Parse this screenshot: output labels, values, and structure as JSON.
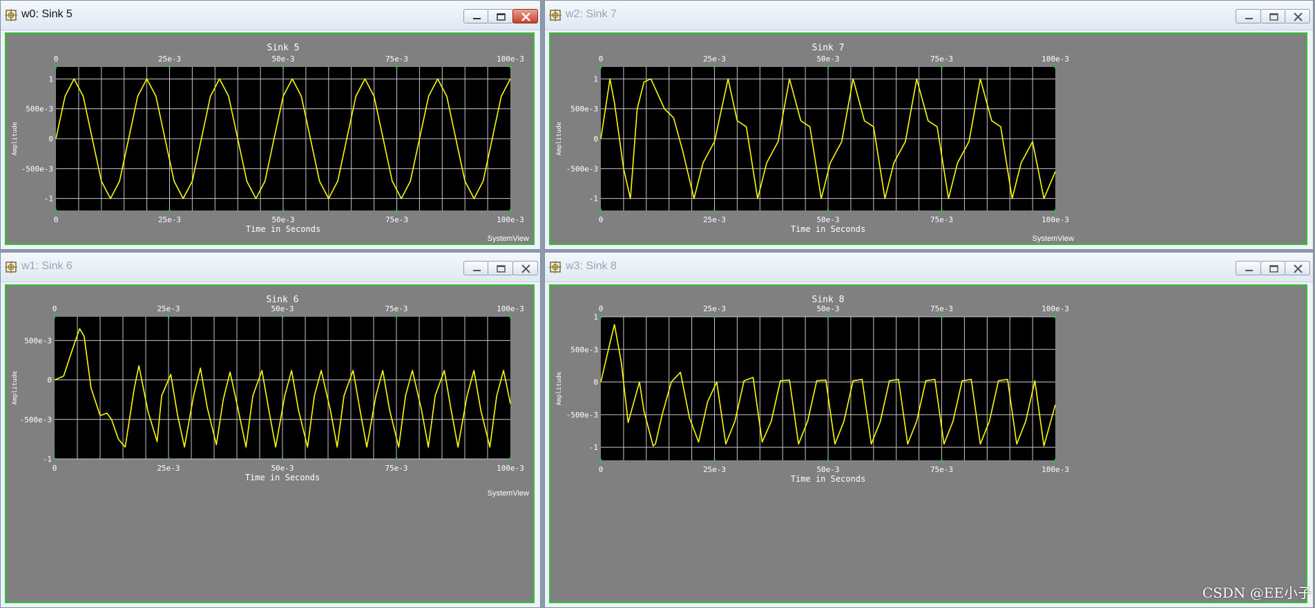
{
  "colors": {
    "trace": "#ffff00",
    "plot_bg": "#000000",
    "panel_bg": "#808080",
    "grid": "#c8c8c8",
    "frame": "#2ec32e"
  },
  "windows": [
    {
      "key": "w0",
      "title": "w0: Sink 5",
      "active": true,
      "brand": "SystemView",
      "icon": "systemview-sink-icon"
    },
    {
      "key": "w2",
      "title": "w2: Sink 7",
      "active": false,
      "brand": "SystemView",
      "icon": "systemview-sink-icon"
    },
    {
      "key": "w1",
      "title": "w1: Sink 6",
      "active": false,
      "brand": "SystemView",
      "icon": "systemview-sink-icon"
    },
    {
      "key": "w3",
      "title": "w3: Sink 8",
      "active": false,
      "brand": "",
      "icon": "systemview-sink-icon"
    }
  ],
  "controls": {
    "minimize": "minimize-icon",
    "restore": "restore-icon",
    "close": "close-icon"
  },
  "watermark": "CSDN @EE小子",
  "chart_data": [
    {
      "type": "line",
      "title": "Sink 5",
      "xlabel": "Time in Seconds",
      "ylabel": "Amplitude",
      "xlim": [
        0,
        0.1
      ],
      "ylim": [
        -1.2,
        1.2
      ],
      "xticks": [
        0,
        0.025,
        0.05,
        0.075,
        0.1
      ],
      "xtick_labels": [
        "0",
        "25e-3",
        "50e-3",
        "75e-3",
        "100e-3"
      ],
      "yticks": [
        1,
        0.5,
        0,
        -0.5,
        -1
      ],
      "ytick_labels": [
        "1",
        "500e-3",
        "0",
        "-500e-3",
        "-1"
      ],
      "grid": true,
      "series": [
        {
          "x": [
            0,
            0.002,
            0.004,
            0.006,
            0.008,
            0.01,
            0.012,
            0.014,
            0.016,
            0.018,
            0.02,
            0.022,
            0.024,
            0.026,
            0.028,
            0.03,
            0.032,
            0.034,
            0.036,
            0.038,
            0.04,
            0.042,
            0.044,
            0.046,
            0.048,
            0.05,
            0.052,
            0.054,
            0.056,
            0.058,
            0.06,
            0.062,
            0.064,
            0.066,
            0.068,
            0.07,
            0.072,
            0.074,
            0.076,
            0.078,
            0.08,
            0.082,
            0.084,
            0.086,
            0.088,
            0.09,
            0.092,
            0.094,
            0.096,
            0.098,
            0.1
          ],
          "y": [
            0,
            0.71,
            1.0,
            0.71,
            0,
            -0.71,
            -1.0,
            -0.71,
            0,
            0.71,
            1.0,
            0.71,
            0,
            -0.71,
            -1.0,
            -0.71,
            0,
            0.71,
            1.0,
            0.71,
            0,
            -0.71,
            -1.0,
            -0.71,
            0,
            0.71,
            1.0,
            0.71,
            0,
            -0.71,
            -1.0,
            -0.71,
            0,
            0.71,
            1.0,
            0.71,
            0,
            -0.71,
            -1.0,
            -0.71,
            0,
            0.71,
            1.0,
            0.71,
            0,
            -0.71,
            -1.0,
            -0.71,
            0,
            0.71,
            1.0
          ]
        }
      ]
    },
    {
      "type": "line",
      "title": "Sink 7",
      "xlabel": "Time in Seconds",
      "ylabel": "Amplitude",
      "xlim": [
        0,
        0.1
      ],
      "ylim": [
        -1.2,
        1.2
      ],
      "xticks": [
        0,
        0.025,
        0.05,
        0.075,
        0.1
      ],
      "xtick_labels": [
        "0",
        "25e-3",
        "50e-3",
        "75e-3",
        "100e-3"
      ],
      "yticks": [
        1,
        0.5,
        0,
        -0.5,
        -1
      ],
      "ytick_labels": [
        "1",
        "500e-3",
        "0",
        "-500e-3",
        "-1"
      ],
      "grid": true,
      "series": [
        {
          "x": [
            0,
            0.002,
            0.003,
            0.005,
            0.0065,
            0.008,
            0.0095,
            0.011,
            0.0125,
            0.014,
            0.016,
            0.018,
            0.0205,
            0.0225,
            0.025,
            0.028,
            0.03,
            0.032,
            0.0345,
            0.0365,
            0.039,
            0.0415,
            0.044,
            0.046,
            0.0485,
            0.0505,
            0.053,
            0.0555,
            0.058,
            0.06,
            0.0625,
            0.0645,
            0.067,
            0.0695,
            0.072,
            0.074,
            0.0765,
            0.0785,
            0.081,
            0.0835,
            0.086,
            0.088,
            0.0905,
            0.0925,
            0.095,
            0.0975,
            0.1
          ],
          "y": [
            0,
            1.0,
            0.6,
            -0.5,
            -1.0,
            0.5,
            0.95,
            1.0,
            0.75,
            0.5,
            0.35,
            -0.2,
            -1.0,
            -0.4,
            -0.05,
            1.0,
            0.3,
            0.2,
            -1.0,
            -0.4,
            -0.05,
            1.0,
            0.3,
            0.2,
            -1.0,
            -0.4,
            -0.05,
            1.0,
            0.3,
            0.2,
            -1.0,
            -0.4,
            -0.05,
            1.0,
            0.3,
            0.2,
            -1.0,
            -0.4,
            -0.05,
            1.0,
            0.3,
            0.2,
            -1.0,
            -0.4,
            -0.05,
            -1.0,
            -0.55
          ]
        }
      ]
    },
    {
      "type": "line",
      "title": "Sink 6",
      "xlabel": "Time in Seconds",
      "ylabel": "Amplitude",
      "xlim": [
        0,
        0.1
      ],
      "ylim": [
        -1.0,
        0.8
      ],
      "xticks": [
        0,
        0.025,
        0.05,
        0.075,
        0.1
      ],
      "xtick_labels": [
        "0",
        "25e-3",
        "50e-3",
        "75e-3",
        "100e-3"
      ],
      "yticks": [
        0.5,
        0,
        -0.5,
        -1
      ],
      "ytick_labels": [
        "500e-3",
        "0",
        "-500e-3",
        "-1"
      ],
      "grid": true,
      "series": [
        {
          "x": [
            0,
            0.002,
            0.004,
            0.0055,
            0.0065,
            0.008,
            0.01,
            0.0115,
            0.0125,
            0.014,
            0.0155,
            0.0175,
            0.0185,
            0.0205,
            0.0225,
            0.0235,
            0.0255,
            0.027,
            0.0285,
            0.0305,
            0.032,
            0.0335,
            0.0355,
            0.037,
            0.0385,
            0.04,
            0.042,
            0.0435,
            0.0455,
            0.047,
            0.0485,
            0.0505,
            0.052,
            0.0535,
            0.0555,
            0.057,
            0.0585,
            0.0605,
            0.062,
            0.0635,
            0.0655,
            0.067,
            0.0685,
            0.0705,
            0.072,
            0.0735,
            0.0755,
            0.077,
            0.0785,
            0.0805,
            0.082,
            0.0835,
            0.0855,
            0.087,
            0.0885,
            0.0905,
            0.092,
            0.0935,
            0.0955,
            0.097,
            0.0985,
            0.1
          ],
          "y": [
            0,
            0.05,
            0.4,
            0.65,
            0.55,
            -0.1,
            -0.45,
            -0.42,
            -0.5,
            -0.75,
            -0.85,
            -0.1,
            0.18,
            -0.4,
            -0.78,
            -0.2,
            0.07,
            -0.45,
            -0.85,
            -0.2,
            0.15,
            -0.35,
            -0.82,
            -0.25,
            0.1,
            -0.3,
            -0.85,
            -0.2,
            0.12,
            -0.38,
            -0.85,
            -0.2,
            0.12,
            -0.38,
            -0.85,
            -0.2,
            0.12,
            -0.38,
            -0.85,
            -0.2,
            0.12,
            -0.38,
            -0.85,
            -0.2,
            0.12,
            -0.38,
            -0.85,
            -0.2,
            0.12,
            -0.38,
            -0.85,
            -0.2,
            0.12,
            -0.38,
            -0.85,
            -0.2,
            0.12,
            -0.38,
            -0.85,
            -0.2,
            0.12,
            -0.3
          ]
        }
      ]
    },
    {
      "type": "line",
      "title": "Sink 8",
      "xlabel": "Time in Seconds",
      "ylabel": "Amplitude",
      "xlim": [
        0,
        0.1
      ],
      "ylim": [
        -1.2,
        1.0
      ],
      "xticks": [
        0,
        0.025,
        0.05,
        0.075,
        0.1
      ],
      "xtick_labels": [
        "0",
        "25e-3",
        "50e-3",
        "75e-3",
        "100e-3"
      ],
      "yticks": [
        1,
        0.5,
        0,
        -0.5,
        -1
      ],
      "ytick_labels": [
        "1",
        "500e-3",
        "0",
        "-500e-3",
        "-1"
      ],
      "grid": true,
      "series": [
        {
          "x": [
            0,
            0.002,
            0.003,
            0.0045,
            0.006,
            0.0075,
            0.0085,
            0.0095,
            0.0115,
            0.012,
            0.0135,
            0.0155,
            0.0175,
            0.0195,
            0.0215,
            0.0235,
            0.0255,
            0.0275,
            0.0295,
            0.0315,
            0.0335,
            0.0355,
            0.0375,
            0.0395,
            0.0415,
            0.0435,
            0.0455,
            0.0475,
            0.0495,
            0.0515,
            0.0535,
            0.0555,
            0.0575,
            0.0595,
            0.0615,
            0.0635,
            0.0655,
            0.0675,
            0.0695,
            0.0715,
            0.0735,
            0.0755,
            0.0775,
            0.0795,
            0.0815,
            0.0835,
            0.0855,
            0.0875,
            0.0895,
            0.0915,
            0.0935,
            0.0955,
            0.0975,
            0.1
          ],
          "y": [
            0,
            0.6,
            0.88,
            0.3,
            -0.62,
            -0.25,
            0.0,
            -0.45,
            -0.98,
            -0.95,
            -0.5,
            0.0,
            0.15,
            -0.55,
            -0.92,
            -0.3,
            0.0,
            -0.95,
            -0.6,
            0.02,
            0.07,
            -0.92,
            -0.6,
            0.02,
            0.03,
            -0.95,
            -0.6,
            0.02,
            0.03,
            -0.95,
            -0.6,
            0.02,
            0.04,
            -0.95,
            -0.6,
            0.02,
            0.04,
            -0.95,
            -0.6,
            0.02,
            0.04,
            -0.95,
            -0.6,
            0.02,
            0.04,
            -0.95,
            -0.6,
            0.02,
            0.04,
            -0.95,
            -0.6,
            0.02,
            -0.98,
            -0.35
          ]
        }
      ]
    }
  ]
}
